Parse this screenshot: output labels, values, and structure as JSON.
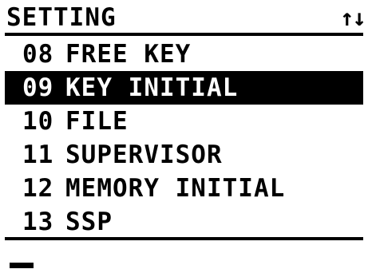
{
  "header": {
    "title": "SETTING",
    "scroll_indicator": "↑↓"
  },
  "menu": {
    "items": [
      {
        "number": "08",
        "label": "FREE KEY",
        "selected": false
      },
      {
        "number": "09",
        "label": "KEY INITIAL",
        "selected": true
      },
      {
        "number": "10",
        "label": "FILE",
        "selected": false
      },
      {
        "number": "11",
        "label": "SUPERVISOR",
        "selected": false
      },
      {
        "number": "12",
        "label": "MEMORY INITIAL",
        "selected": false
      },
      {
        "number": "13",
        "label": "SSP",
        "selected": false
      }
    ]
  },
  "input": {
    "value": ""
  },
  "colors": {
    "foreground": "#000000",
    "background": "#ffffff"
  }
}
